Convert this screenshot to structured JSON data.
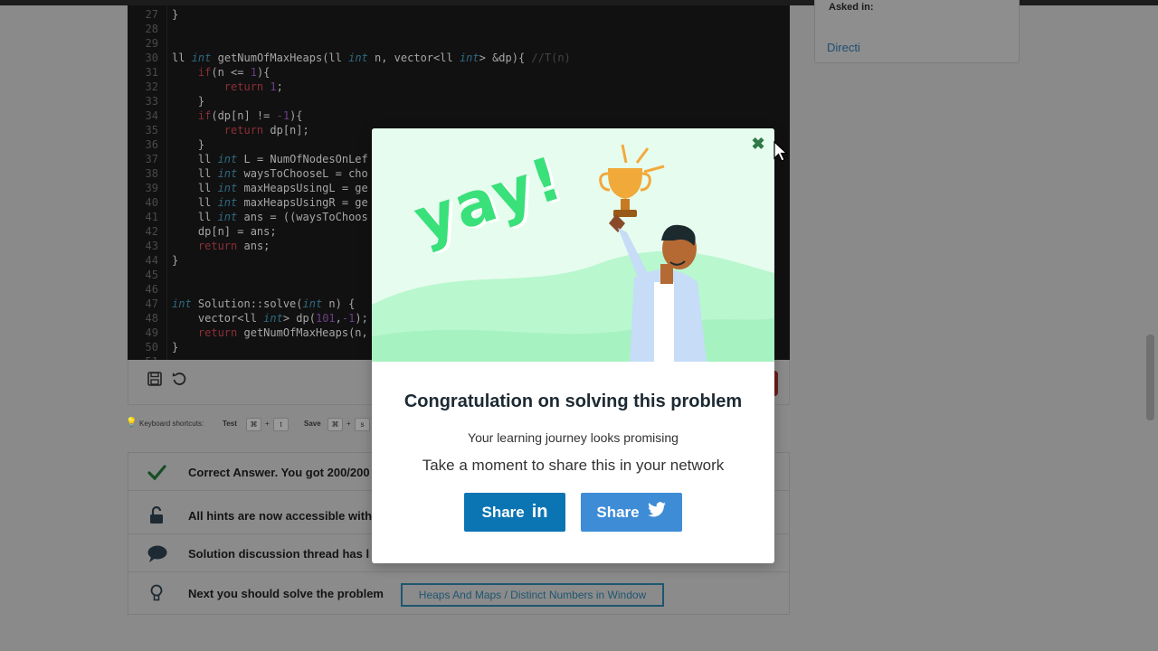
{
  "editor": {
    "lines": [
      {
        "n": "27",
        "t": [
          [
            "}",
            ""
          ]
        ]
      },
      {
        "n": "28",
        "t": []
      },
      {
        "n": "29",
        "t": []
      },
      {
        "n": "30",
        "t": [
          [
            "ll ",
            ""
          ],
          [
            "int",
            "kw"
          ],
          [
            " getNumOfMaxHeaps(ll ",
            ""
          ],
          [
            "int",
            "kw"
          ],
          [
            " n, vector<ll ",
            ""
          ],
          [
            "int",
            "kw"
          ],
          [
            "> &dp){ ",
            ""
          ],
          [
            "//T(n)",
            "cm"
          ]
        ]
      },
      {
        "n": "31",
        "t": [
          [
            "    ",
            ""
          ],
          [
            "if",
            "ctl"
          ],
          [
            "(n <= ",
            ""
          ],
          [
            "1",
            "num"
          ],
          [
            "){",
            ""
          ]
        ]
      },
      {
        "n": "32",
        "t": [
          [
            "        ",
            ""
          ],
          [
            "return",
            "ctl"
          ],
          [
            " ",
            ""
          ],
          [
            "1",
            "num"
          ],
          [
            ";",
            ""
          ]
        ]
      },
      {
        "n": "33",
        "t": [
          [
            "    }",
            ""
          ]
        ]
      },
      {
        "n": "34",
        "t": [
          [
            "    ",
            ""
          ],
          [
            "if",
            "ctl"
          ],
          [
            "(dp[n] != ",
            ""
          ],
          [
            "-1",
            "num"
          ],
          [
            "){",
            ""
          ]
        ]
      },
      {
        "n": "35",
        "t": [
          [
            "        ",
            ""
          ],
          [
            "return",
            "ctl"
          ],
          [
            " dp[n];",
            ""
          ]
        ]
      },
      {
        "n": "36",
        "t": [
          [
            "    }",
            ""
          ]
        ]
      },
      {
        "n": "37",
        "t": [
          [
            "    ll ",
            ""
          ],
          [
            "int",
            "kw"
          ],
          [
            " L = NumOfNodesOnLef",
            ""
          ]
        ]
      },
      {
        "n": "38",
        "t": [
          [
            "    ll ",
            ""
          ],
          [
            "int",
            "kw"
          ],
          [
            " waysToChooseL = cho",
            ""
          ]
        ]
      },
      {
        "n": "39",
        "t": [
          [
            "    ll ",
            ""
          ],
          [
            "int",
            "kw"
          ],
          [
            " maxHeapsUsingL = ge",
            ""
          ]
        ]
      },
      {
        "n": "40",
        "t": [
          [
            "    ll ",
            ""
          ],
          [
            "int",
            "kw"
          ],
          [
            " maxHeapsUsingR = ge",
            ""
          ]
        ]
      },
      {
        "n": "41",
        "t": [
          [
            "    ll ",
            ""
          ],
          [
            "int",
            "kw"
          ],
          [
            " ans = ((waysToChoos",
            ""
          ]
        ]
      },
      {
        "n": "42",
        "t": [
          [
            "    dp[n] = ans;",
            ""
          ]
        ]
      },
      {
        "n": "43",
        "t": [
          [
            "    ",
            ""
          ],
          [
            "return",
            "ctl"
          ],
          [
            " ans;",
            ""
          ]
        ]
      },
      {
        "n": "44",
        "t": [
          [
            "}",
            ""
          ]
        ]
      },
      {
        "n": "45",
        "t": []
      },
      {
        "n": "46",
        "t": []
      },
      {
        "n": "47",
        "t": [
          [
            "int",
            "kw"
          ],
          [
            " Solution::solve(",
            ""
          ],
          [
            "int",
            "kw"
          ],
          [
            " n) {",
            ""
          ]
        ]
      },
      {
        "n": "48",
        "t": [
          [
            "    vector<ll ",
            ""
          ],
          [
            "int",
            "kw"
          ],
          [
            "> dp(",
            ""
          ],
          [
            "101",
            "num"
          ],
          [
            ",",
            ""
          ],
          [
            "-1",
            "num"
          ],
          [
            ");",
            ""
          ]
        ]
      },
      {
        "n": "49",
        "t": [
          [
            "    ",
            ""
          ],
          [
            "return",
            "ctl"
          ],
          [
            " getNumOfMaxHeaps(n,",
            ""
          ]
        ]
      },
      {
        "n": "50",
        "t": [
          [
            "}",
            ""
          ]
        ]
      },
      {
        "n": "51",
        "t": []
      }
    ]
  },
  "toolbar": {
    "save_icon": "save-icon",
    "reset_icon": "undo-icon"
  },
  "shortcuts": {
    "label": "Keyboard shortcuts:",
    "test_label": "Test",
    "test_keys": [
      "⌘",
      "t"
    ],
    "save_label": "Save",
    "save_keys": [
      "⌘",
      "s"
    ],
    "plus": "+"
  },
  "results": {
    "rows": [
      {
        "icon": "check-icon",
        "text": "Correct Answer. You got 200/200"
      },
      {
        "icon": "unlock-icon",
        "text": "All hints are now accessible with"
      },
      {
        "icon": "chat-icon",
        "text": "Solution discussion thread has l"
      },
      {
        "icon": "bulb-icon",
        "text": "Next you should solve the problem"
      }
    ],
    "next_problem": "Heaps And Maps / Distinct Numbers in Window"
  },
  "sidebar": {
    "asked_in_label": "Asked in:",
    "company": "Directi"
  },
  "modal": {
    "hero_text": "yay!",
    "title": "Congratulation on solving this problem",
    "subtitle": "Your learning journey looks promising",
    "share_prompt": "Take a moment to share this in your network",
    "share_linkedin_label": "Share",
    "linkedin_glyph": "in",
    "share_twitter_label": "Share",
    "close_glyph": "✖"
  },
  "colors": {
    "linkedin": "#0b74b3",
    "twitter": "#3e8cd6",
    "hero_bg": "#e6fcee",
    "hero_green": "#3ae07a",
    "accent_green": "#2f7a47"
  }
}
